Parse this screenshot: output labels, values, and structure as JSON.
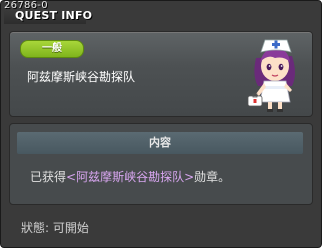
{
  "window": {
    "id": "26786-0",
    "title": "QUEST INFO"
  },
  "quest": {
    "category": "一般",
    "name": "阿兹摩斯峡谷勘探队",
    "character_icon": "nurse-character-icon"
  },
  "content": {
    "header": "内容",
    "text_prefix": "已获得",
    "text_highlight": "<阿兹摩斯峡谷勘探队>",
    "text_suffix": "勋章。"
  },
  "status": {
    "label": "狀態:",
    "value": "可開始"
  },
  "colors": {
    "badge_green": "#8cc424",
    "highlight_purple": "#d8a6f0",
    "panel_gray": "#474b4d"
  }
}
